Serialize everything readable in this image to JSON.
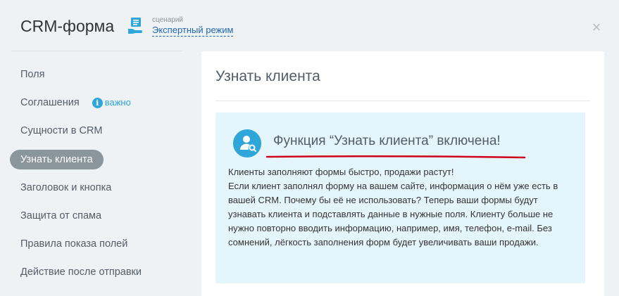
{
  "header": {
    "title": "CRM-форма",
    "scenario": {
      "caption": "сценарий",
      "value": "Экспертный режим"
    },
    "close_icon": "×"
  },
  "sidebar": {
    "items": [
      {
        "label": "Поля"
      },
      {
        "label": "Соглашения",
        "badge": {
          "icon": "i",
          "text": "важно"
        }
      },
      {
        "label": "Сущности в CRM"
      },
      {
        "label": "Узнать клиента",
        "active": true
      },
      {
        "label": "Заголовок и кнопка"
      },
      {
        "label": "Защита от спама"
      },
      {
        "label": "Правила показа полей"
      },
      {
        "label": "Действие после отправки"
      }
    ]
  },
  "main": {
    "title": "Узнать клиента",
    "info": {
      "heading": "Функция “Узнать клиента” включена!",
      "line1": "Клиенты заполняют формы быстро, продажи растут!",
      "line2": "Если клиент заполнял форму на вашем сайте, информация о нём уже есть в вашей CRM. Почему бы её не использовать? Теперь ваши формы будут узнавать клиента и подставлять данные в нужные поля. Клиенту больше не нужно повторно вводить информацию, например, имя, телефон, e-mail. Без сомнений, лёгкость заполнения форм будет увеличивать ваши продажи."
    }
  },
  "colors": {
    "accent": "#2fa6d9",
    "link": "#2067b0",
    "active_nav": "#8a959c",
    "info_bg": "#e5f5fc",
    "underline": "#d0021b"
  }
}
